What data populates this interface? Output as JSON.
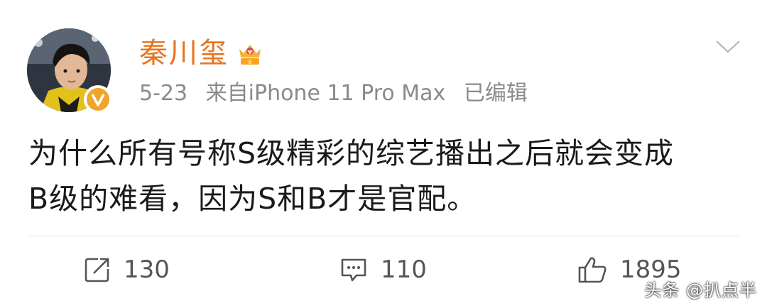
{
  "post": {
    "author": {
      "name": "秦川玺",
      "avatar_icon": "person-avatar",
      "verified_icon": "verified-v-badge",
      "member_icon": "crown-icon"
    },
    "meta": {
      "date": "5-23",
      "source": "来自iPhone 11 Pro Max",
      "edited": "已编辑"
    },
    "content": {
      "line1": "为什么所有号称S级精彩的综艺播出之后就会变成",
      "line2": "B级的难看，因为S和B才是官配。"
    },
    "actions": {
      "repost_count": "130",
      "comment_count": "110",
      "like_count": "1895"
    },
    "watermark": "头条 @扒点半",
    "colors": {
      "username": "#e8741f",
      "meta": "#8a8a8a",
      "text": "#1a1a1a",
      "badge": "#f0a526"
    }
  }
}
